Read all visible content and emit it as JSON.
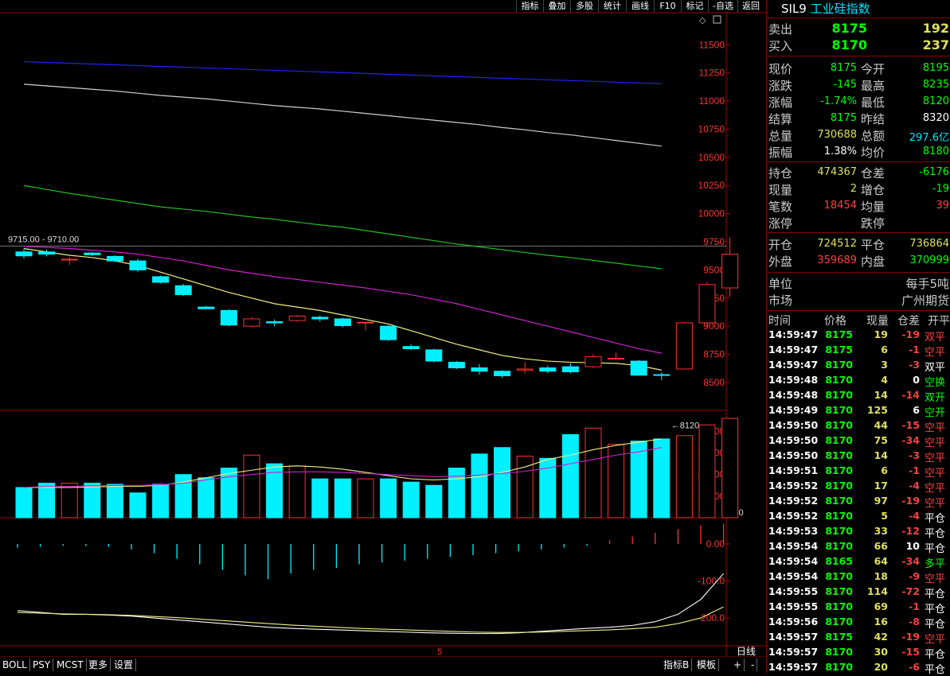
{
  "toolbar": {
    "items": [
      "指标",
      "叠加",
      "多股",
      "统计",
      "画线",
      "F10",
      "标记",
      "-自选",
      "返回"
    ]
  },
  "instrument": {
    "code": "SIL9",
    "name": "工业硅指数"
  },
  "quote": {
    "sell_label": "卖出",
    "sell_price": "8175",
    "sell_vol": "192",
    "buy_label": "买入",
    "buy_price": "8170",
    "buy_vol": "237",
    "rows": [
      {
        "l1": "现价",
        "v1": "8175",
        "c1": "#00ff00",
        "l2": "今开",
        "v2": "8195",
        "c2": "#00ff00"
      },
      {
        "l1": "涨跌",
        "v1": "-145",
        "c1": "#00ff00",
        "l2": "最高",
        "v2": "8235",
        "c2": "#00ff00"
      },
      {
        "l1": "涨幅",
        "v1": "-1.74%",
        "c1": "#00ff00",
        "l2": "最低",
        "v2": "8120",
        "c2": "#00ff00"
      },
      {
        "l1": "结算",
        "v1": "8175",
        "c1": "#00ff00",
        "l2": "昨结",
        "v2": "8320",
        "c2": "#ffffff"
      },
      {
        "l1": "总量",
        "v1": "730688",
        "c1": "#e0e060",
        "l2": "总额",
        "v2": "297.6亿",
        "c2": "#00e5ff"
      },
      {
        "l1": "振幅",
        "v1": "1.38%",
        "c1": "#ffffff",
        "l2": "均价",
        "v2": "8180",
        "c2": "#00ff00"
      }
    ],
    "rows2": [
      {
        "l1": "持仓",
        "v1": "474367",
        "c1": "#e0e060",
        "l2": "仓差",
        "v2": "-6176",
        "c2": "#00ff00"
      },
      {
        "l1": "现量",
        "v1": "2",
        "c1": "#e0e060",
        "l2": "增仓",
        "v2": "-19",
        "c2": "#00ff00"
      },
      {
        "l1": "笔数",
        "v1": "18454",
        "c1": "#ff4040",
        "l2": "均量",
        "v2": "39",
        "c2": "#ff4040"
      },
      {
        "l1": "涨停",
        "v1": "",
        "c1": "#ff4040",
        "l2": "跌停",
        "v2": "",
        "c2": "#00ff00"
      }
    ],
    "rows3": [
      {
        "l1": "开仓",
        "v1": "724512",
        "c1": "#e0e060",
        "l2": "平仓",
        "v2": "736864",
        "c2": "#e0e060"
      },
      {
        "l1": "外盘",
        "v1": "359689",
        "c1": "#ff4040",
        "l2": "内盘",
        "v2": "370999",
        "c2": "#00ff00"
      }
    ],
    "unit_label": "单位",
    "unit_value": "每手5吨",
    "market_label": "市场",
    "market_value": "广州期货"
  },
  "ticks_header": {
    "time": "时间",
    "price": "价格",
    "qty": "现量",
    "oi": "仓差",
    "type": "开平"
  },
  "ticks": [
    {
      "time": "14:59:47",
      "price": "8175",
      "qty": "19",
      "oi": "-19",
      "type": "双平",
      "tc": "#ff4040"
    },
    {
      "time": "14:59:47",
      "price": "8175",
      "qty": "6",
      "oi": "-1",
      "type": "空平",
      "tc": "#ff4040"
    },
    {
      "time": "14:59:47",
      "price": "8170",
      "qty": "3",
      "oi": "-3",
      "type": "双平",
      "tc": "#ffffff"
    },
    {
      "time": "14:59:48",
      "price": "8170",
      "qty": "4",
      "oi": "0",
      "type": "空换",
      "tc": "#00ff00"
    },
    {
      "time": "14:59:48",
      "price": "8170",
      "qty": "14",
      "oi": "-14",
      "type": "双开",
      "tc": "#00ff00"
    },
    {
      "time": "14:59:49",
      "price": "8170",
      "qty": "125",
      "oi": "6",
      "type": "空开",
      "tc": "#00ff00"
    },
    {
      "time": "14:59:50",
      "price": "8170",
      "qty": "44",
      "oi": "-15",
      "type": "空平",
      "tc": "#ff4040"
    },
    {
      "time": "14:59:50",
      "price": "8170",
      "qty": "75",
      "oi": "-34",
      "type": "空平",
      "tc": "#ff4040"
    },
    {
      "time": "14:59:50",
      "price": "8170",
      "qty": "14",
      "oi": "-3",
      "type": "空平",
      "tc": "#ff4040"
    },
    {
      "time": "14:59:51",
      "price": "8170",
      "qty": "6",
      "oi": "-1",
      "type": "空平",
      "tc": "#ff4040"
    },
    {
      "time": "14:59:52",
      "price": "8170",
      "qty": "17",
      "oi": "-4",
      "type": "空平",
      "tc": "#ff4040"
    },
    {
      "time": "14:59:52",
      "price": "8170",
      "qty": "97",
      "oi": "-19",
      "type": "空平",
      "tc": "#ff4040"
    },
    {
      "time": "14:59:52",
      "price": "8170",
      "qty": "5",
      "oi": "-4",
      "type": "平仓",
      "tc": "#ffffff"
    },
    {
      "time": "14:59:53",
      "price": "8170",
      "qty": "33",
      "oi": "-12",
      "type": "平仓",
      "tc": "#ffffff"
    },
    {
      "time": "14:59:54",
      "price": "8170",
      "qty": "66",
      "oi": "10",
      "type": "平仓",
      "tc": "#ffffff"
    },
    {
      "time": "14:59:54",
      "price": "8165",
      "qty": "64",
      "oi": "-34",
      "type": "多平",
      "tc": "#00ff00"
    },
    {
      "time": "14:59:54",
      "price": "8170",
      "qty": "18",
      "oi": "-9",
      "type": "空平",
      "tc": "#ff4040"
    },
    {
      "time": "14:59:55",
      "price": "8170",
      "qty": "114",
      "oi": "-72",
      "type": "平仓",
      "tc": "#ffffff"
    },
    {
      "time": "14:59:55",
      "price": "8170",
      "qty": "69",
      "oi": "-1",
      "type": "平仓",
      "tc": "#ffffff"
    },
    {
      "time": "14:59:56",
      "price": "8170",
      "qty": "16",
      "oi": "-8",
      "type": "平仓",
      "tc": "#ffffff"
    },
    {
      "time": "14:59:57",
      "price": "8175",
      "qty": "42",
      "oi": "-19",
      "type": "空平",
      "tc": "#ff4040"
    },
    {
      "time": "14:59:57",
      "price": "8170",
      "qty": "30",
      "oi": "-15",
      "type": "平仓",
      "tc": "#ffffff"
    },
    {
      "time": "14:59:57",
      "price": "8170",
      "qty": "20",
      "oi": "-6",
      "type": "平仓",
      "tc": "#ffffff"
    }
  ],
  "bottom_tabs": [
    "BOLL",
    "PSY",
    "MCST",
    "更多",
    "设置"
  ],
  "bottom_right": [
    "指标B",
    "模板",
    "+",
    "-"
  ],
  "period_label": "日线",
  "x_marker": "5",
  "colors": {
    "up": "#ff3030",
    "down": "#00f0ff",
    "frame": "#a00000",
    "axis_text": "#ff3030"
  },
  "chart_data": {
    "type": "candlestick",
    "title": "",
    "price_ylim": [
      8330,
      11700
    ],
    "price_ticks": [
      8500,
      8750,
      9000,
      9250,
      9500,
      9750,
      10000,
      10250,
      10500,
      10750,
      11000,
      11250,
      11500
    ],
    "top_left_label": "9715.00 - 9710.00",
    "low_marker_label": "8120",
    "candles": [
      {
        "o": 9660,
        "h": 9690,
        "l": 9600,
        "c": 9625
      },
      {
        "o": 9660,
        "h": 9680,
        "l": 9620,
        "c": 9640
      },
      {
        "o": 9595,
        "h": 9615,
        "l": 9545,
        "c": 9595
      },
      {
        "o": 9650,
        "h": 9660,
        "l": 9625,
        "c": 9635
      },
      {
        "o": 9620,
        "h": 9630,
        "l": 9570,
        "c": 9580
      },
      {
        "o": 9580,
        "h": 9600,
        "l": 9480,
        "c": 9500
      },
      {
        "o": 9440,
        "h": 9450,
        "l": 9380,
        "c": 9390
      },
      {
        "o": 9360,
        "h": 9375,
        "l": 9270,
        "c": 9280
      },
      {
        "o": 9170,
        "h": 9180,
        "l": 9150,
        "c": 9155
      },
      {
        "o": 9140,
        "h": 9150,
        "l": 9000,
        "c": 9010
      },
      {
        "o": 9000,
        "h": 9080,
        "l": 8990,
        "c": 9065
      },
      {
        "o": 9040,
        "h": 9060,
        "l": 9000,
        "c": 9030
      },
      {
        "o": 9050,
        "h": 9100,
        "l": 9040,
        "c": 9090
      },
      {
        "o": 9080,
        "h": 9095,
        "l": 9040,
        "c": 9065
      },
      {
        "o": 9065,
        "h": 9075,
        "l": 8990,
        "c": 9005
      },
      {
        "o": 9030,
        "h": 9040,
        "l": 8960,
        "c": 9035
      },
      {
        "o": 9000,
        "h": 9010,
        "l": 8870,
        "c": 8880
      },
      {
        "o": 8820,
        "h": 8840,
        "l": 8790,
        "c": 8800
      },
      {
        "o": 8790,
        "h": 8800,
        "l": 8680,
        "c": 8690
      },
      {
        "o": 8680,
        "h": 8690,
        "l": 8620,
        "c": 8630
      },
      {
        "o": 8630,
        "h": 8665,
        "l": 8570,
        "c": 8600
      },
      {
        "o": 8600,
        "h": 8610,
        "l": 8540,
        "c": 8560
      },
      {
        "o": 8610,
        "h": 8680,
        "l": 8580,
        "c": 8620
      },
      {
        "o": 8630,
        "h": 8650,
        "l": 8580,
        "c": 8600
      },
      {
        "o": 8640,
        "h": 8670,
        "l": 8580,
        "c": 8595
      },
      {
        "o": 8640,
        "h": 8750,
        "l": 8630,
        "c": 8730
      },
      {
        "o": 8710,
        "h": 8765,
        "l": 8700,
        "c": 8715
      },
      {
        "o": 8690,
        "h": 8700,
        "l": 8560,
        "c": 8565
      },
      {
        "o": 8570,
        "h": 8590,
        "l": 8520,
        "c": 8565
      },
      {
        "o": 8620,
        "h": 9040,
        "l": 8615,
        "c": 9030
      },
      {
        "o": 9030,
        "h": 9390,
        "l": 8990,
        "c": 9370
      },
      {
        "o": 9340,
        "h": 9790,
        "l": 9260,
        "c": 9640
      }
    ],
    "ma_short": [
      9690,
      9660,
      9630,
      9610,
      9580,
      9540,
      9480,
      9420,
      9360,
      9300,
      9250,
      9200,
      9170,
      9140,
      9100,
      9060,
      9020,
      8960,
      8900,
      8840,
      8790,
      8740,
      8710,
      8690,
      8680,
      8675,
      8670,
      8650,
      8610
    ],
    "ma_mid": [
      9710,
      9700,
      9690,
      9675,
      9660,
      9640,
      9610,
      9580,
      9540,
      9500,
      9470,
      9440,
      9415,
      9390,
      9365,
      9340,
      9310,
      9280,
      9240,
      9200,
      9150,
      9100,
      9050,
      9000,
      8950,
      8900,
      8850,
      8800,
      8760
    ],
    "ma_long": [
      10250,
      10215,
      10180,
      10150,
      10120,
      10090,
      10060,
      10040,
      10020,
      9995,
      9970,
      9950,
      9925,
      9900,
      9880,
      9850,
      9820,
      9790,
      9760,
      9730,
      9705,
      9680,
      9655,
      9630,
      9610,
      9585,
      9560,
      9535,
      9510
    ],
    "ma_xlong": [
      11150,
      11135,
      11120,
      11105,
      11090,
      11070,
      11050,
      11035,
      11020,
      11000,
      10980,
      10960,
      10945,
      10930,
      10910,
      10890,
      10870,
      10850,
      10830,
      10810,
      10790,
      10765,
      10745,
      10720,
      10700,
      10675,
      10650,
      10625,
      10600
    ],
    "ma_xxlong": [
      11350,
      11343,
      11336,
      11329,
      11322,
      11315,
      11308,
      11301,
      11294,
      11287,
      11280,
      11273,
      11266,
      11259,
      11252,
      11245,
      11238,
      11231,
      11224,
      11217,
      11210,
      11203,
      11196,
      11189,
      11182,
      11175,
      11168,
      11161,
      11154
    ],
    "volume_ylim": [
      0,
      95000
    ],
    "volume_ticks": [
      20000,
      40000,
      60000,
      80000
    ],
    "volume_scale_label": "X10",
    "volumes": [
      28000,
      32000,
      32000,
      32000,
      31000,
      23000,
      31000,
      40000,
      37000,
      46000,
      58000,
      50000,
      48000,
      36000,
      36000,
      36000,
      36000,
      33000,
      30000,
      46000,
      59000,
      65000,
      57000,
      55000,
      77000,
      83000,
      68000,
      71000,
      73000,
      76000,
      86000,
      92000
    ],
    "vol_ma1": [
      28000,
      28000,
      28000,
      28500,
      29000,
      29000,
      30000,
      33000,
      37000,
      41000,
      44000,
      47000,
      48000,
      47000,
      45000,
      42000,
      39000,
      36000,
      35000,
      36000,
      38000,
      42000,
      47000,
      54000,
      58000,
      63000,
      67000,
      70000,
      73000
    ],
    "vol_ma2": [
      28000,
      29000,
      29000,
      29500,
      30000,
      30000,
      30500,
      32000,
      35000,
      38000,
      40000,
      42000,
      42500,
      42500,
      42000,
      41000,
      40000,
      39000,
      38000,
      38500,
      39500,
      41000,
      43000,
      46000,
      50000,
      54000,
      58000,
      61000,
      65000
    ],
    "macd_ylim": [
      -260,
      60
    ],
    "macd_ticks": [
      0.0,
      -100.0,
      -200.0
    ],
    "macd_hist": [
      -10,
      -8,
      -5,
      -6,
      -8,
      -15,
      -25,
      -40,
      -55,
      -70,
      -85,
      -95,
      -80,
      -70,
      -65,
      -55,
      -50,
      -45,
      -40,
      -35,
      -30,
      -25,
      -20,
      -15,
      -10,
      -5,
      10,
      20,
      30,
      40,
      50,
      55
    ],
    "macd_dif": [
      -180,
      -185,
      -190,
      -190,
      -192,
      -195,
      -200,
      -205,
      -210,
      -215,
      -220,
      -225,
      -228,
      -230,
      -232,
      -234,
      -236,
      -238,
      -240,
      -241,
      -242,
      -242,
      -240,
      -236,
      -232,
      -228,
      -225,
      -220,
      -210,
      -190,
      -150,
      -80
    ],
    "macd_dea": [
      -185,
      -187,
      -189,
      -190,
      -191,
      -193,
      -196,
      -199,
      -203,
      -207,
      -211,
      -215,
      -219,
      -222,
      -225,
      -228,
      -230,
      -232,
      -234,
      -236,
      -238,
      -239,
      -239,
      -238,
      -236,
      -234,
      -232,
      -229,
      -225,
      -215,
      -200,
      -170
    ]
  }
}
